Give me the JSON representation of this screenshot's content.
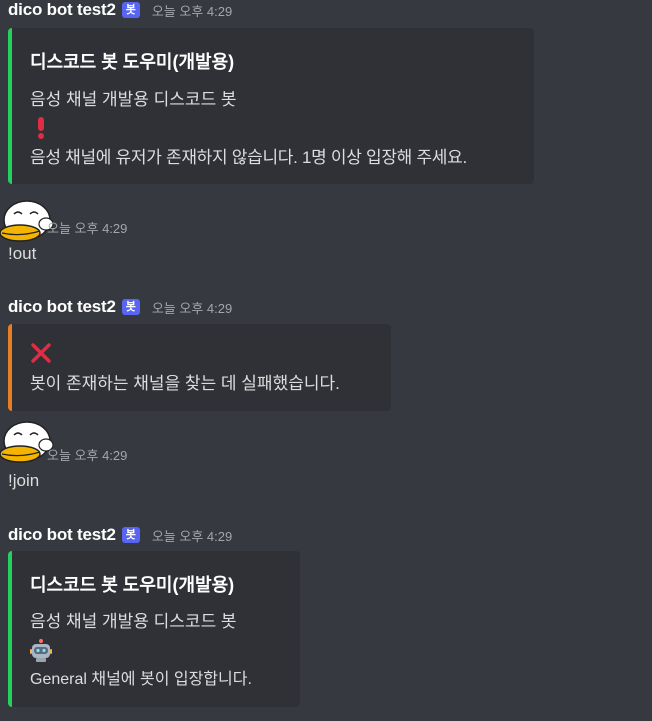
{
  "messages": [
    {
      "author": "dico bot test2",
      "bot_tag": "봇",
      "timestamp": "오늘 오후 4:29",
      "embed": {
        "title": "디스코드 봇 도우미(개발용)",
        "description": "음성 채널 개발용 디스코드 봇",
        "icon": "exclamation-icon",
        "text": "음성 채널에 유저가 존재하지 않습니다. 1명 이상 입장해 주세요."
      }
    },
    {
      "timestamp": "오늘 오후 4:29",
      "content": "!out"
    },
    {
      "author": "dico bot test2",
      "bot_tag": "봇",
      "timestamp": "오늘 오후 4:29",
      "embed": {
        "icon": "cross-mark-icon",
        "text": "봇이 존재하는 채널을 찾는 데 실패했습니다."
      }
    },
    {
      "timestamp": "오늘 오후 4:29",
      "content": "!join"
    },
    {
      "author": "dico bot test2",
      "bot_tag": "봇",
      "timestamp": "오늘 오후 4:29",
      "embed": {
        "title": "디스코드 봇 도우미(개발용)",
        "description": "음성 채널 개발용 디스코드 봇",
        "icon": "robot-icon",
        "text": "General 채널에 봇이 입장합니다."
      }
    }
  ],
  "colors": {
    "background": "#36393f",
    "embed_bg": "#2f3136",
    "green_bar": "#23d160",
    "orange_bar": "#e67e22",
    "bot_tag": "#5865f2"
  }
}
